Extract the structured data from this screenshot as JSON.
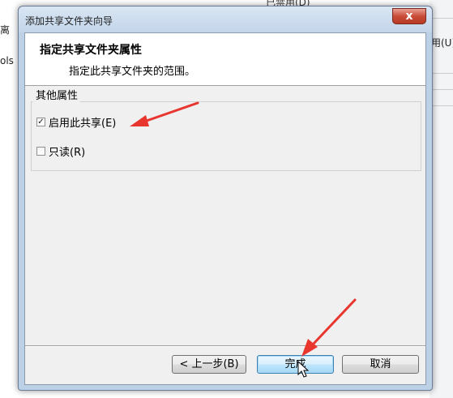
{
  "background": {
    "left_fragments": [
      "离",
      "ols"
    ],
    "right_fragments": [
      "用(U)"
    ],
    "top_fragment": "已禁用(D)"
  },
  "dialog": {
    "title": "添加共享文件夹向导",
    "close_glyph": "x",
    "header": {
      "title": "指定共享文件夹属性",
      "subtitle": "指定此共享文件夹的范围。"
    },
    "group": {
      "label": "其他属性",
      "options": [
        {
          "label": "启用此共享(E)",
          "checked": true
        },
        {
          "label": "只读(R)",
          "checked": false
        }
      ]
    },
    "buttons": {
      "back": "< 上一步(B)",
      "finish": "完成",
      "cancel": "取消"
    }
  },
  "annotation_color": "#e8362f"
}
